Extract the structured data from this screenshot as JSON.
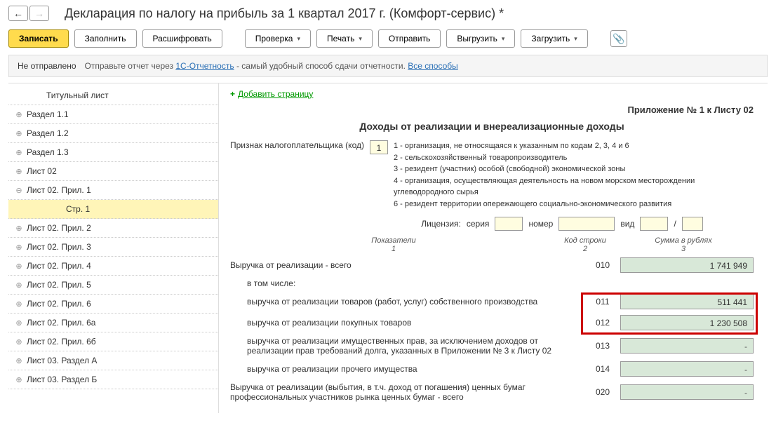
{
  "title": "Декларация по налогу на прибыль за 1 квартал 2017 г. (Комфорт-сервис) *",
  "toolbar": {
    "save": "Записать",
    "fill": "Заполнить",
    "decrypt": "Расшифровать",
    "check": "Проверка",
    "print": "Печать",
    "send": "Отправить",
    "export": "Выгрузить",
    "import": "Загрузить"
  },
  "status": {
    "notSent": "Не отправлено",
    "sendHint": "Отправьте отчет через ",
    "link1": "1С-Отчетность",
    "sendHint2": " - самый удобный способ сдачи отчетности. ",
    "link2": "Все способы"
  },
  "tree": [
    {
      "label": "Титульный лист",
      "indent": 1,
      "icon": "none"
    },
    {
      "label": "Раздел 1.1",
      "indent": 0,
      "icon": "plus"
    },
    {
      "label": "Раздел 1.2",
      "indent": 0,
      "icon": "plus"
    },
    {
      "label": "Раздел 1.3",
      "indent": 0,
      "icon": "plus"
    },
    {
      "label": "Лист 02",
      "indent": 0,
      "icon": "plus"
    },
    {
      "label": "Лист 02. Прил. 1",
      "indent": 0,
      "icon": "minus"
    },
    {
      "label": "Стр. 1",
      "indent": 2,
      "icon": "none",
      "selected": true
    },
    {
      "label": "Лист 02. Прил. 2",
      "indent": 0,
      "icon": "plus"
    },
    {
      "label": "Лист 02. Прил. 3",
      "indent": 0,
      "icon": "plus"
    },
    {
      "label": "Лист 02. Прил. 4",
      "indent": 0,
      "icon": "plus"
    },
    {
      "label": "Лист 02. Прил. 5",
      "indent": 0,
      "icon": "plus"
    },
    {
      "label": "Лист 02. Прил. 6",
      "indent": 0,
      "icon": "plus"
    },
    {
      "label": "Лист 02. Прил. 6а",
      "indent": 0,
      "icon": "plus"
    },
    {
      "label": "Лист 02. Прил. 6б",
      "indent": 0,
      "icon": "plus"
    },
    {
      "label": "Лист 03. Раздел А",
      "indent": 0,
      "icon": "plus"
    },
    {
      "label": "Лист 03. Раздел Б",
      "indent": 0,
      "icon": "plus"
    }
  ],
  "content": {
    "addPage": "Добавить страницу",
    "appLabel": "Приложение № 1 к Листу 02",
    "sectionTitle": "Доходы от реализации и внереализационные доходы",
    "taxpayerLabel": "Признак налогоплательщика (код)",
    "taxpayerCode": "1",
    "codes": {
      "c1": "1 - организация, не относящаяся к указанным по кодам 2, 3, 4 и 6",
      "c2": "2 - сельскохозяйственный товаропроизводитель",
      "c3": "3 - резидент (участник) особой (свободной) экономической зоны",
      "c4": "4 - организация, осуществляющая деятельность на новом морском месторождении углеводородного сырья",
      "c6": "6 - резидент территории опережающего социально-экономического развития"
    },
    "license": {
      "label": "Лицензия:",
      "seria": "серия",
      "num": "номер",
      "vid": "вид",
      "sep": "/"
    },
    "headers": {
      "ind": "Показатели\n1",
      "code": "Код строки\n2",
      "sum": "Сумма в рублях\n3"
    },
    "rows": [
      {
        "label": "Выручка от реализации - всего",
        "code": "010",
        "value": "1 741 949",
        "indent": false
      },
      {
        "label": "в том числе:",
        "code": "",
        "value": "",
        "indent": true,
        "novalue": true
      },
      {
        "label": "выручка от реализации товаров (работ, услуг) собственного производства",
        "code": "011",
        "value": "511 441",
        "indent": true,
        "highlight": true
      },
      {
        "label": "выручка от реализации покупных товаров",
        "code": "012",
        "value": "1 230 508",
        "indent": true,
        "highlight": true
      },
      {
        "label": "выручка от реализации имущественных прав, за исключением доходов от реализации прав требований долга, указанных в Приложении № 3 к Листу 02",
        "code": "013",
        "value": "-",
        "indent": true,
        "dash": true
      },
      {
        "label": "выручка от реализации прочего имущества",
        "code": "014",
        "value": "-",
        "indent": true,
        "dash": true
      },
      {
        "label": "Выручка от реализации (выбытия, в т.ч. доход от погашения) ценных бумаг профессиональных участников рынка ценных бумаг - всего",
        "code": "020",
        "value": "-",
        "indent": false,
        "dash": true
      }
    ]
  }
}
